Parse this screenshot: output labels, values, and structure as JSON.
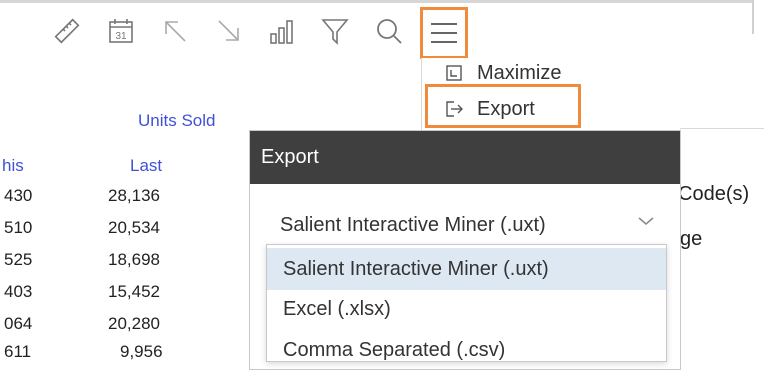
{
  "toolbar": {
    "icons": [
      "ruler-icon",
      "calendar-icon",
      "arrow-up-left-icon",
      "arrow-down-right-icon",
      "bar-chart-icon",
      "filter-icon",
      "search-icon",
      "hamburger-menu-icon"
    ],
    "calendar_day": "31"
  },
  "menu": {
    "maximize_label": "Maximize",
    "export_label": "Export"
  },
  "table": {
    "group_header": "Units Sold",
    "columns": [
      "his",
      "Last"
    ],
    "rows": [
      {
        "this": "430",
        "last": "28,136"
      },
      {
        "this": "510",
        "last": "20,534"
      },
      {
        "this": "525",
        "last": "18,698"
      },
      {
        "this": "403",
        "last": "15,452"
      },
      {
        "this": "064",
        "last": "20,280"
      },
      {
        "this": "611",
        "last": "9,956"
      }
    ]
  },
  "side_panel": {
    "code_label": "Code(s)",
    "ge_label": "ge"
  },
  "dialog": {
    "title": "Export",
    "selected_format": "Salient Interactive Miner (.uxt)",
    "options": [
      "Salient Interactive Miner (.uxt)",
      "Excel (.xlsx)",
      "Comma Separated (.csv)"
    ]
  },
  "colors": {
    "highlight": "#f08a3c",
    "header_bg": "#3f3f3f",
    "link_blue": "#4050d8",
    "option_selected_bg": "#dde8f3"
  }
}
